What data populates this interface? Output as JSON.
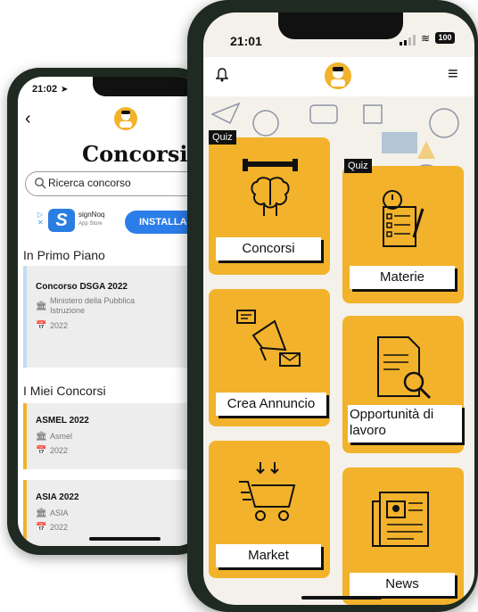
{
  "back_phone": {
    "status_time": "21:02",
    "back_icon": "back-arrow-icon",
    "title": "Concorsi",
    "search_placeholder": "Ricerca concorso",
    "ad": {
      "logo_letter": "S",
      "brand": "signNoq",
      "store": "App Store",
      "install_label": "INSTALLA"
    },
    "in_primo_piano_title": "In Primo Piano",
    "featured": [
      {
        "title": "Concorso DSGA 2022",
        "org": "Ministero della Pubblica Istruzione",
        "year": "2022"
      }
    ],
    "miei_concorsi_title": "I Miei Concorsi",
    "my_items": [
      {
        "title": "ASMEL 2022",
        "org": "Asmel",
        "year": "2022"
      },
      {
        "title": "ASIA 2022",
        "org": "ASIA",
        "year": "2022"
      }
    ]
  },
  "front_phone": {
    "status_time": "21:01",
    "battery": "100",
    "tiles": {
      "concorsi": {
        "label": "Concorsi",
        "badge": "Quiz"
      },
      "materie": {
        "label": "Materie",
        "badge": "Quiz"
      },
      "crea_annuncio": {
        "label": "Crea Annuncio"
      },
      "opportunita": {
        "label": "Opportunità di lavoro"
      },
      "market": {
        "label": "Market"
      },
      "news": {
        "label": "News"
      }
    }
  },
  "colors": {
    "accent": "#f2b22b",
    "dark": "#111111",
    "featured_bar": "#bfdcf2",
    "my_bar": "#f2b22b",
    "install_blue": "#2b7de9"
  }
}
